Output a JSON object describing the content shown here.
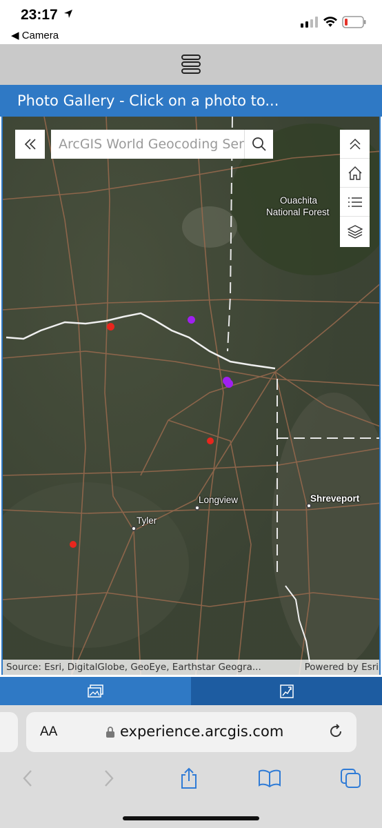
{
  "status_bar": {
    "time": "23:17",
    "back_app": "◀ Camera"
  },
  "title_bar": {
    "title": "Photo Gallery - Click on a photo to..."
  },
  "map": {
    "search": {
      "placeholder": "ArcGIS World Geocoding Service"
    },
    "labels": {
      "ouachita_line1": "Ouachita",
      "ouachita_line2": "National Forest",
      "longview": "Longview",
      "tyler": "Tyler",
      "shreveport": "Shreveport"
    },
    "attribution": {
      "source": "Source: Esri, DigitalGlobe, GeoEye, Earthstar Geogra...",
      "powered": "Powered by Esri"
    },
    "marker_colors": {
      "red": "#e8261d",
      "purple": "#a020f0"
    }
  },
  "safari": {
    "aa_label": "AA",
    "url": "experience.arcgis.com"
  },
  "colors": {
    "accent": "#2f79c5",
    "accent_dark": "#1d5ca1",
    "ios_blue": "#2f7bd6"
  }
}
